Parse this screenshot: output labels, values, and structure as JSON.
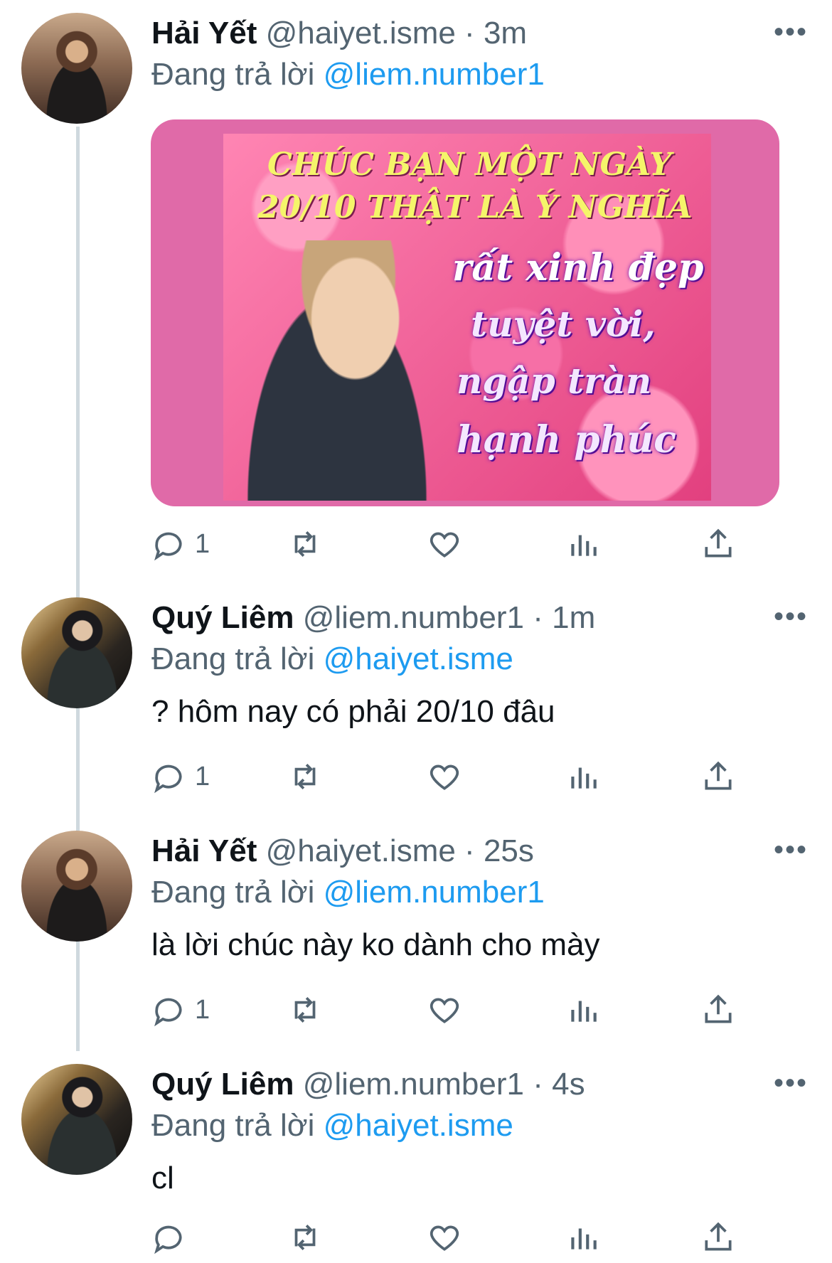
{
  "tweets": [
    {
      "name": "Hải Yết",
      "handle": "@haiyet.isme",
      "dot": "·",
      "time": "3m",
      "reply_prefix": "Đang trả lời",
      "reply_to": "@liem.number1",
      "text": "",
      "media": {
        "lines": [
          "CHÚC BẠN MỘT NGÀY",
          "20/10 THẬT LÀ Ý NGHĨA",
          "rất xinh đẹp",
          "tuyệt vời,",
          "ngập tràn",
          "hạnh phúc"
        ]
      },
      "reply_count": "1",
      "avatar": "warm"
    },
    {
      "name": "Quý Liêm",
      "handle": "@liem.number1",
      "dot": "·",
      "time": "1m",
      "reply_prefix": "Đang trả lời",
      "reply_to": "@haiyet.isme",
      "text": "? hôm nay có phải 20/10 đâu",
      "reply_count": "1",
      "avatar": "night"
    },
    {
      "name": "Hải Yết",
      "handle": "@haiyet.isme",
      "dot": "·",
      "time": "25s",
      "reply_prefix": "Đang trả lời",
      "reply_to": "@liem.number1",
      "text": "là lời chúc này ko dành cho mày",
      "reply_count": "1",
      "avatar": "warm"
    },
    {
      "name": "Quý Liêm",
      "handle": "@liem.number1",
      "dot": "·",
      "time": "4s",
      "reply_prefix": "Đang trả lời",
      "reply_to": "@haiyet.isme",
      "text": "cl",
      "reply_count": "",
      "avatar": "night"
    }
  ],
  "icons": {
    "more": "more-options-icon",
    "reply": "reply-icon",
    "retweet": "retweet-icon",
    "like": "like-icon",
    "views": "views-icon",
    "share": "share-icon"
  },
  "colors": {
    "link": "#1d9bf0",
    "muted": "#536471",
    "text": "#0f1419",
    "thread_line": "#cfd9de"
  }
}
